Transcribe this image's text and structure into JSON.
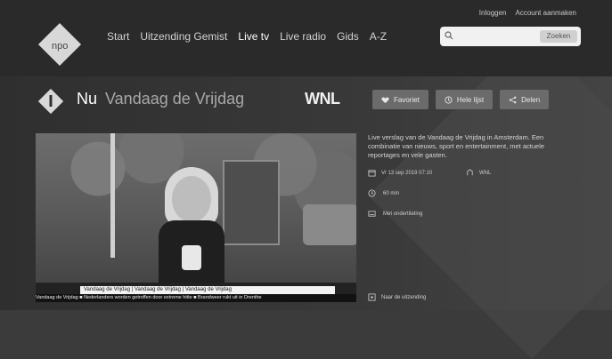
{
  "topbar": {
    "links": [
      "Inloggen",
      "Account aanmaken"
    ]
  },
  "nav": {
    "items": [
      "Start",
      "Uitzending Gemist",
      "Live tv",
      "Live radio",
      "Gids",
      "A-Z"
    ],
    "active_index": 2
  },
  "search": {
    "placeholder": "",
    "button_label": "Zoeken"
  },
  "header": {
    "now_label": "Nu",
    "title": "Vandaag de Vrijdag",
    "channel_mark": "WNL"
  },
  "actions": [
    {
      "label": "Favoriet",
      "icon": "heart-icon"
    },
    {
      "label": "Hele lijst",
      "icon": "clock-icon"
    },
    {
      "label": "Delen",
      "icon": "share-icon"
    }
  ],
  "video": {
    "ticker_top": "Vandaag de Vrijdag  |  Vandaag de Vrijdag  |  Vandaag de Vrijdag",
    "ticker_bottom": "Vandaag de Vrijdag  ■  Nederlanders worden getroffen door extreme hitte  ■  Brandweer rukt uit in Drenthe"
  },
  "info": {
    "description": "Live verslag van de Vandaag de Vrijdag in Amsterdam. Een combinatie van nieuws, sport en entertainment, met actuele reportages en vele gasten.",
    "meta": {
      "date": "Vr 13 sep 2019 07:10",
      "channel": "WNL",
      "duration": "60 min",
      "subtitle": "Met ondertiteling",
      "bottom_link": "Naar de uitzending"
    }
  },
  "colors": {
    "accent": "#d9d9d9",
    "header_bg": "#2a2a2a",
    "button_bg": "#6b6b6b"
  }
}
